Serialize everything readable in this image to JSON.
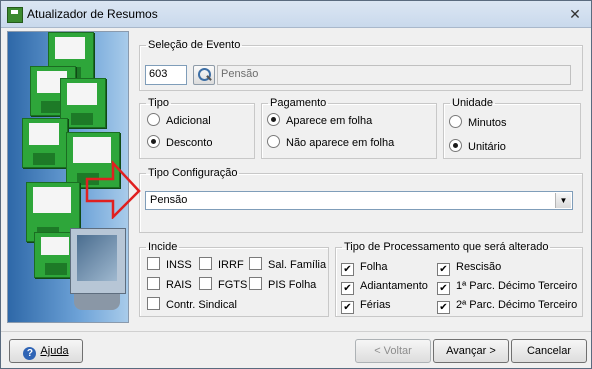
{
  "window": {
    "title": "Atualizador de  Resumos",
    "close_glyph": "✕"
  },
  "evento": {
    "legend": "Seleção de Evento",
    "code": "603",
    "description": "Pensão"
  },
  "tipo": {
    "legend": "Tipo",
    "options": [
      {
        "label": "Adicional",
        "selected": false
      },
      {
        "label": "Desconto",
        "selected": true
      }
    ]
  },
  "pagamento": {
    "legend": "Pagamento",
    "options": [
      {
        "label": "Aparece em folha",
        "selected": true
      },
      {
        "label": "Não aparece em folha",
        "selected": false
      }
    ]
  },
  "unidade": {
    "legend": "Unidade",
    "options": [
      {
        "label": "Minutos",
        "selected": false
      },
      {
        "label": "Unitário",
        "selected": true
      }
    ]
  },
  "configuracao": {
    "legend": "Tipo Configuração",
    "selected": "Pensão",
    "arrow_color": "#e02020"
  },
  "incide": {
    "legend": "Incide",
    "items": [
      {
        "label": "INSS",
        "checked": false
      },
      {
        "label": "IRRF",
        "checked": false
      },
      {
        "label": "Sal. Família",
        "checked": false
      },
      {
        "label": "RAIS",
        "checked": false
      },
      {
        "label": "FGTS",
        "checked": false
      },
      {
        "label": "PIS Folha",
        "checked": false
      },
      {
        "label": "Contr. Sindical",
        "checked": false
      }
    ]
  },
  "processamento": {
    "legend": "Tipo de Processamento que será alterado",
    "items": [
      {
        "label": "Folha",
        "checked": true
      },
      {
        "label": "Rescisão",
        "checked": true
      },
      {
        "label": "Adiantamento",
        "checked": true
      },
      {
        "label": "1ª Parc. Décimo Terceiro",
        "checked": true
      },
      {
        "label": "Férias",
        "checked": true
      },
      {
        "label": "2ª Parc. Décimo Terceiro",
        "checked": true
      }
    ]
  },
  "buttons": {
    "help": "Ajuda",
    "back": "< Voltar",
    "next": "Avançar >",
    "cancel": "Cancelar"
  }
}
